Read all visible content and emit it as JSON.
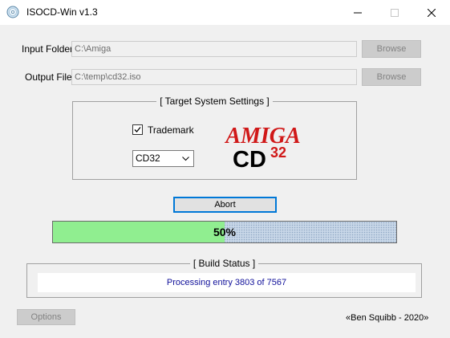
{
  "window": {
    "title": "ISOCD-Win v1.3",
    "icons": {
      "app": "cd-disc-icon",
      "minimize": "minimize-icon",
      "maximize": "maximize-icon",
      "close": "close-icon"
    }
  },
  "input_folder": {
    "label": "Input Folder",
    "value": "C:\\Amiga",
    "button": "Browse"
  },
  "output_file": {
    "label": "Output File",
    "value": "C:\\temp\\cd32.iso",
    "button": "Browse"
  },
  "target_settings": {
    "title": "[ Target System Settings ]",
    "trademark": {
      "label": "Trademark",
      "checked": true
    },
    "system_select": {
      "selected": "CD32"
    },
    "logo": {
      "line1": "AMIGA",
      "line2": "CD",
      "superscript": "32",
      "color": "#d01818"
    }
  },
  "abort_button": "Abort",
  "progress": {
    "fraction": 0.5,
    "text": "50%",
    "fill_color": "#90ee90"
  },
  "build_status": {
    "title": "[ Build Status ]",
    "message": "Processing entry 3803 of 7567"
  },
  "options_button": "Options",
  "credit": "«Ben Squibb - 2020»"
}
